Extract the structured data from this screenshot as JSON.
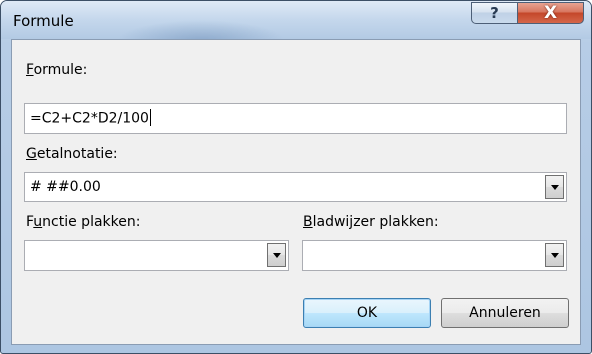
{
  "window": {
    "title": "Formule",
    "help_glyph": "?",
    "close_glyph": "X"
  },
  "formula": {
    "label_accel": "F",
    "label_rest": "ormule:",
    "value": "=C2+C2*D2/100"
  },
  "number_format": {
    "label_accel": "G",
    "label_rest": "etalnotatie:",
    "value": "# ##0.00"
  },
  "paste_function": {
    "label_before": "F",
    "label_accel": "u",
    "label_after": "nctie plakken:",
    "value": ""
  },
  "paste_bookmark": {
    "label_accel": "B",
    "label_rest": "ladwijzer plakken:",
    "value": ""
  },
  "buttons": {
    "ok": "OK",
    "cancel": "Annuleren"
  }
}
